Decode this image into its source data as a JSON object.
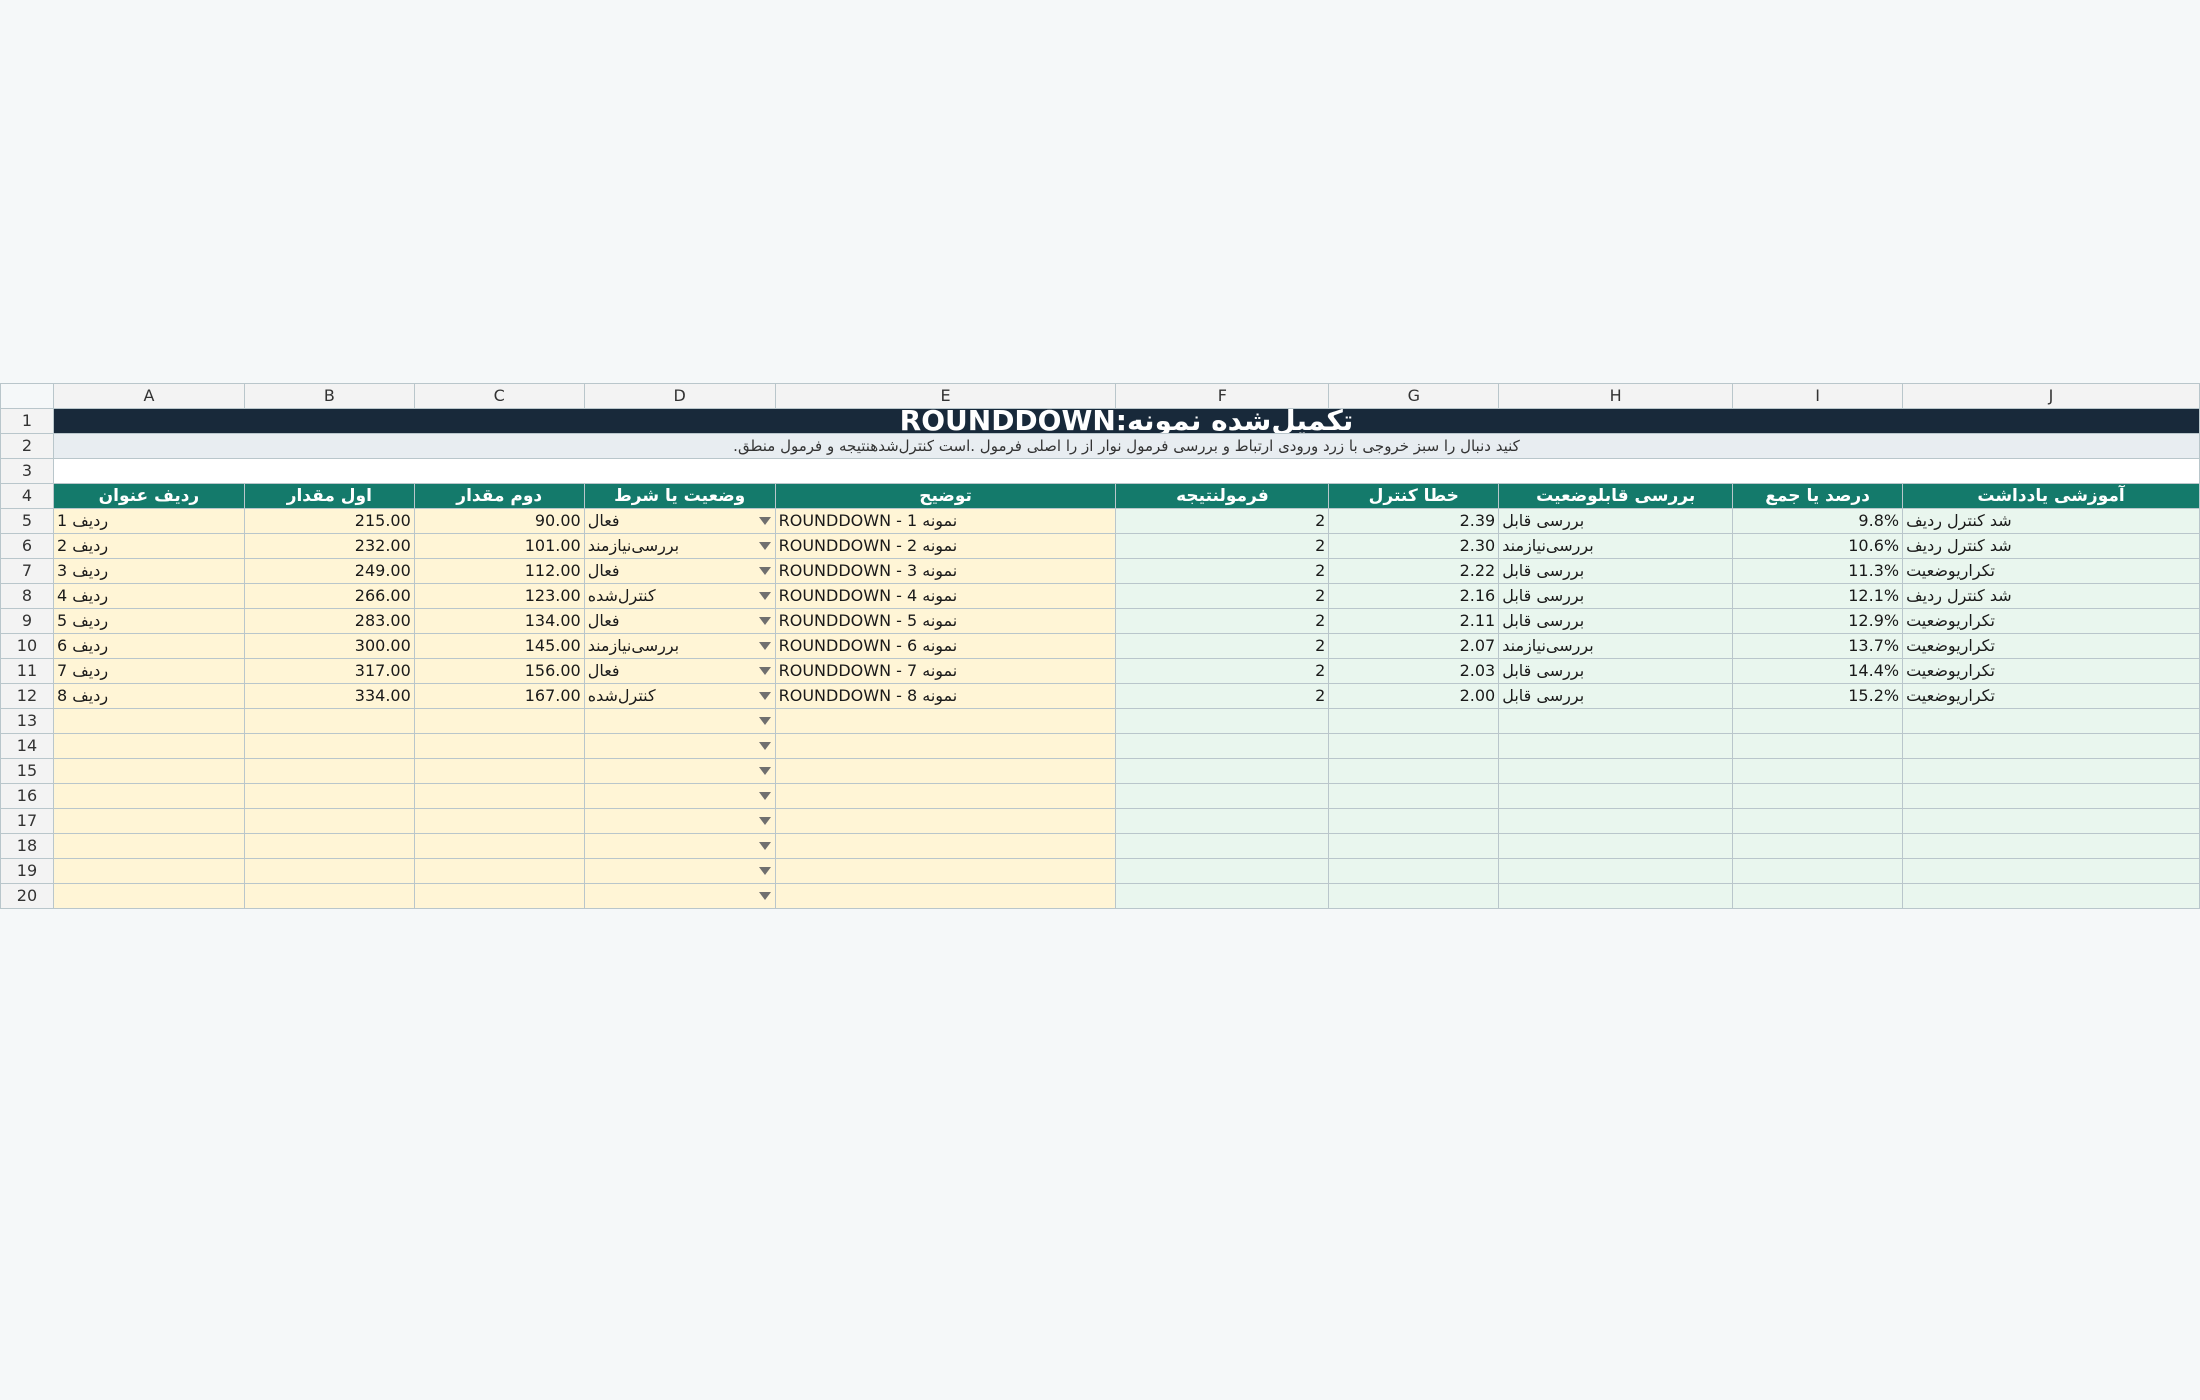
{
  "columns": [
    "A",
    "B",
    "C",
    "D",
    "E",
    "F",
    "G",
    "H",
    "I",
    "J"
  ],
  "row_numbers": [
    "1",
    "2",
    "3",
    "4",
    "5",
    "6",
    "7",
    "8",
    "9",
    "10",
    "11",
    "12",
    "13",
    "14",
    "15",
    "16",
    "17",
    "18",
    "19",
    "20"
  ],
  "title": "ROUNDDOWN:تکمیل‌شده نمونه",
  "subtitle": ".کنید دنبال را سبز خروجی با زرد ورودی ارتباط و بررسی فرمول نوار از را اصلی فرمول .است کنترل‌شدهنتیجه و فرمول منطق",
  "headers": [
    "ردیف عنوان",
    "اول مقدار",
    "دوم مقدار",
    "وضعیت یا شرط",
    "توضیح",
    "فرمولنتیجه",
    "خطا کنترل",
    "بررسی قابلوضعیت",
    "درصد یا جمع",
    "آموزشی یادداشت"
  ],
  "rows": [
    [
      "1 ردیف",
      "215.00",
      "90.00",
      "فعال",
      "ROUNDDOWN - 1 نمونه",
      "2",
      "2.39",
      "بررسی قابل",
      "9.8%",
      "شد کنترل ردیف"
    ],
    [
      "2 ردیف",
      "232.00",
      "101.00",
      "بررسی‌نیازمند",
      "ROUNDDOWN - 2 نمونه",
      "2",
      "2.30",
      "بررسی‌نیازمند",
      "10.6%",
      "شد کنترل ردیف"
    ],
    [
      "3 ردیف",
      "249.00",
      "112.00",
      "فعال",
      "ROUNDDOWN - 3 نمونه",
      "2",
      "2.22",
      "بررسی قابل",
      "11.3%",
      "تکراریوضعیت"
    ],
    [
      "4 ردیف",
      "266.00",
      "123.00",
      "کنترل‌شده",
      "ROUNDDOWN - 4 نمونه",
      "2",
      "2.16",
      "بررسی قابل",
      "12.1%",
      "شد کنترل ردیف"
    ],
    [
      "5 ردیف",
      "283.00",
      "134.00",
      "فعال",
      "ROUNDDOWN - 5 نمونه",
      "2",
      "2.11",
      "بررسی قابل",
      "12.9%",
      "تکراریوضعیت"
    ],
    [
      "6 ردیف",
      "300.00",
      "145.00",
      "بررسی‌نیازمند",
      "ROUNDDOWN - 6 نمونه",
      "2",
      "2.07",
      "بررسی‌نیازمند",
      "13.7%",
      "تکراریوضعیت"
    ],
    [
      "7 ردیف",
      "317.00",
      "156.00",
      "فعال",
      "ROUNDDOWN - 7 نمونه",
      "2",
      "2.03",
      "بررسی قابل",
      "14.4%",
      "تکراریوضعیت"
    ],
    [
      "8 ردیف",
      "334.00",
      "167.00",
      "کنترل‌شده",
      "ROUNDDOWN - 8 نمونه",
      "2",
      "2.00",
      "بررسی قابل",
      "15.2%",
      "تکراریوضعیت"
    ]
  ],
  "empty_rows": 8,
  "colors": {
    "title_bg": "#18293a",
    "header_bg": "#147a6b",
    "input_bg": "#fff5d6",
    "output_bg": "#e9f6ee",
    "subtitle_bg": "#e8edf1"
  }
}
